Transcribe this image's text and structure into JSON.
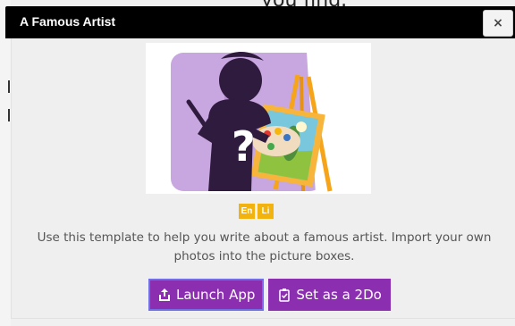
{
  "background_text": "you find.",
  "dialog": {
    "title": "A Famous Artist",
    "close_label": "×",
    "badges": [
      "En",
      "Li"
    ],
    "description": "Use this template to help you write about a famous artist. Import your own photos into the picture boxes.",
    "buttons": {
      "launch": "Launch App",
      "set2do": "Set as a 2Do"
    }
  },
  "colors": {
    "header": "#000000",
    "button_bg": "#8b2fb0",
    "badge": "#f3b30f",
    "art_purple_bg": "#c8a6df",
    "silhouette": "#2e1b3e"
  },
  "icons": {
    "launch": "share-upload-icon",
    "set2do": "clipboard-check-icon",
    "close": "close-icon"
  }
}
